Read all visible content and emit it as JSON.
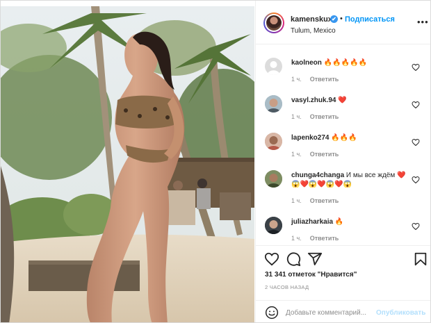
{
  "post": {
    "username": "kamenskux",
    "verified_mark": "✔",
    "separator": "•",
    "follow_label": "Подписаться",
    "location": "Tulum, Mexico",
    "more_icon": "more-horizontal-icon",
    "more_glyph": "•••"
  },
  "comments": [
    {
      "username": "kaolneon",
      "text": "🔥🔥🔥🔥🔥",
      "time": "1 ч.",
      "reply_label": "Ответить",
      "avatar_color": "#dcdcdc"
    },
    {
      "username": "vasyl.zhuk.94",
      "text": "❤️",
      "time": "1 ч.",
      "reply_label": "Ответить",
      "avatar_color": "#8ea7b5"
    },
    {
      "username": "lapenko274",
      "text": "🔥🔥🔥",
      "time": "1 ч.",
      "reply_label": "Ответить",
      "avatar_color": "#c59a87"
    },
    {
      "username": "chunga4changa",
      "text": "И мы все ждём ❤️😱❤️😱❤️😱❤️😱",
      "time": "1 ч.",
      "reply_label": "Ответить",
      "avatar_color": "#6f7f5a"
    },
    {
      "username": "juliazharkaia",
      "text": "🔥",
      "time": "1 ч.",
      "reply_label": "Ответить",
      "avatar_color": "#2d3338"
    }
  ],
  "actions": {
    "like_icon": "heart-icon",
    "comment_icon": "comment-icon",
    "share_icon": "share-icon",
    "save_icon": "bookmark-icon",
    "likes_text": "31 341 отметок \"Нравится\"",
    "time_ago": "2 ЧАСОВ НАЗАД"
  },
  "add_comment": {
    "emoji_icon": "smile-icon",
    "placeholder": "Добавьте комментарий...",
    "publish_label": "Опубликовать"
  },
  "colors": {
    "accent": "#0095f6",
    "publish_disabled": "#b2dffc",
    "text": "#262626",
    "muted": "#8e8e8e"
  }
}
